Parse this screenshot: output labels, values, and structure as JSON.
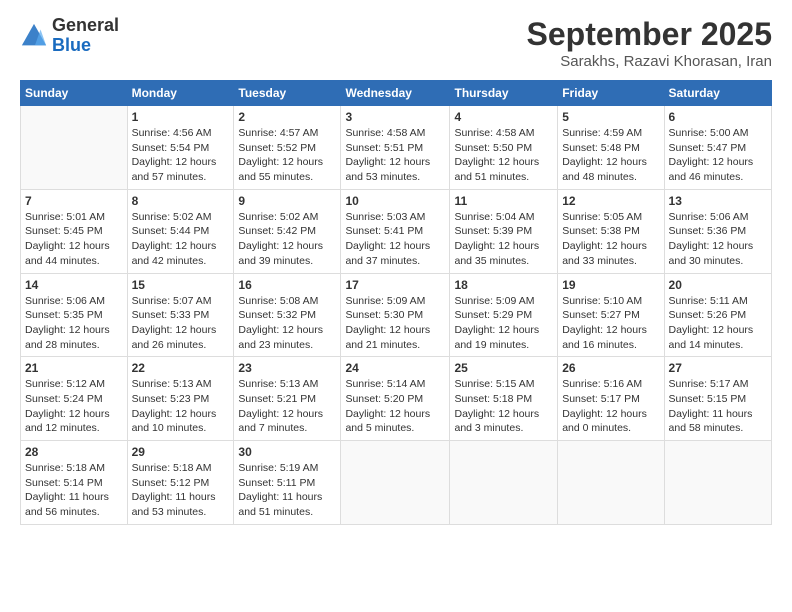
{
  "header": {
    "logo": {
      "general": "General",
      "blue": "Blue"
    },
    "title": "September 2025",
    "location": "Sarakhs, Razavi Khorasan, Iran"
  },
  "calendar": {
    "days_of_week": [
      "Sunday",
      "Monday",
      "Tuesday",
      "Wednesday",
      "Thursday",
      "Friday",
      "Saturday"
    ],
    "weeks": [
      [
        {
          "day": "",
          "info": ""
        },
        {
          "day": "1",
          "info": "Sunrise: 4:56 AM\nSunset: 5:54 PM\nDaylight: 12 hours\nand 57 minutes."
        },
        {
          "day": "2",
          "info": "Sunrise: 4:57 AM\nSunset: 5:52 PM\nDaylight: 12 hours\nand 55 minutes."
        },
        {
          "day": "3",
          "info": "Sunrise: 4:58 AM\nSunset: 5:51 PM\nDaylight: 12 hours\nand 53 minutes."
        },
        {
          "day": "4",
          "info": "Sunrise: 4:58 AM\nSunset: 5:50 PM\nDaylight: 12 hours\nand 51 minutes."
        },
        {
          "day": "5",
          "info": "Sunrise: 4:59 AM\nSunset: 5:48 PM\nDaylight: 12 hours\nand 48 minutes."
        },
        {
          "day": "6",
          "info": "Sunrise: 5:00 AM\nSunset: 5:47 PM\nDaylight: 12 hours\nand 46 minutes."
        }
      ],
      [
        {
          "day": "7",
          "info": "Sunrise: 5:01 AM\nSunset: 5:45 PM\nDaylight: 12 hours\nand 44 minutes."
        },
        {
          "day": "8",
          "info": "Sunrise: 5:02 AM\nSunset: 5:44 PM\nDaylight: 12 hours\nand 42 minutes."
        },
        {
          "day": "9",
          "info": "Sunrise: 5:02 AM\nSunset: 5:42 PM\nDaylight: 12 hours\nand 39 minutes."
        },
        {
          "day": "10",
          "info": "Sunrise: 5:03 AM\nSunset: 5:41 PM\nDaylight: 12 hours\nand 37 minutes."
        },
        {
          "day": "11",
          "info": "Sunrise: 5:04 AM\nSunset: 5:39 PM\nDaylight: 12 hours\nand 35 minutes."
        },
        {
          "day": "12",
          "info": "Sunrise: 5:05 AM\nSunset: 5:38 PM\nDaylight: 12 hours\nand 33 minutes."
        },
        {
          "day": "13",
          "info": "Sunrise: 5:06 AM\nSunset: 5:36 PM\nDaylight: 12 hours\nand 30 minutes."
        }
      ],
      [
        {
          "day": "14",
          "info": "Sunrise: 5:06 AM\nSunset: 5:35 PM\nDaylight: 12 hours\nand 28 minutes."
        },
        {
          "day": "15",
          "info": "Sunrise: 5:07 AM\nSunset: 5:33 PM\nDaylight: 12 hours\nand 26 minutes."
        },
        {
          "day": "16",
          "info": "Sunrise: 5:08 AM\nSunset: 5:32 PM\nDaylight: 12 hours\nand 23 minutes."
        },
        {
          "day": "17",
          "info": "Sunrise: 5:09 AM\nSunset: 5:30 PM\nDaylight: 12 hours\nand 21 minutes."
        },
        {
          "day": "18",
          "info": "Sunrise: 5:09 AM\nSunset: 5:29 PM\nDaylight: 12 hours\nand 19 minutes."
        },
        {
          "day": "19",
          "info": "Sunrise: 5:10 AM\nSunset: 5:27 PM\nDaylight: 12 hours\nand 16 minutes."
        },
        {
          "day": "20",
          "info": "Sunrise: 5:11 AM\nSunset: 5:26 PM\nDaylight: 12 hours\nand 14 minutes."
        }
      ],
      [
        {
          "day": "21",
          "info": "Sunrise: 5:12 AM\nSunset: 5:24 PM\nDaylight: 12 hours\nand 12 minutes."
        },
        {
          "day": "22",
          "info": "Sunrise: 5:13 AM\nSunset: 5:23 PM\nDaylight: 12 hours\nand 10 minutes."
        },
        {
          "day": "23",
          "info": "Sunrise: 5:13 AM\nSunset: 5:21 PM\nDaylight: 12 hours\nand 7 minutes."
        },
        {
          "day": "24",
          "info": "Sunrise: 5:14 AM\nSunset: 5:20 PM\nDaylight: 12 hours\nand 5 minutes."
        },
        {
          "day": "25",
          "info": "Sunrise: 5:15 AM\nSunset: 5:18 PM\nDaylight: 12 hours\nand 3 minutes."
        },
        {
          "day": "26",
          "info": "Sunrise: 5:16 AM\nSunset: 5:17 PM\nDaylight: 12 hours\nand 0 minutes."
        },
        {
          "day": "27",
          "info": "Sunrise: 5:17 AM\nSunset: 5:15 PM\nDaylight: 11 hours\nand 58 minutes."
        }
      ],
      [
        {
          "day": "28",
          "info": "Sunrise: 5:18 AM\nSunset: 5:14 PM\nDaylight: 11 hours\nand 56 minutes."
        },
        {
          "day": "29",
          "info": "Sunrise: 5:18 AM\nSunset: 5:12 PM\nDaylight: 11 hours\nand 53 minutes."
        },
        {
          "day": "30",
          "info": "Sunrise: 5:19 AM\nSunset: 5:11 PM\nDaylight: 11 hours\nand 51 minutes."
        },
        {
          "day": "",
          "info": ""
        },
        {
          "day": "",
          "info": ""
        },
        {
          "day": "",
          "info": ""
        },
        {
          "day": "",
          "info": ""
        }
      ]
    ]
  }
}
